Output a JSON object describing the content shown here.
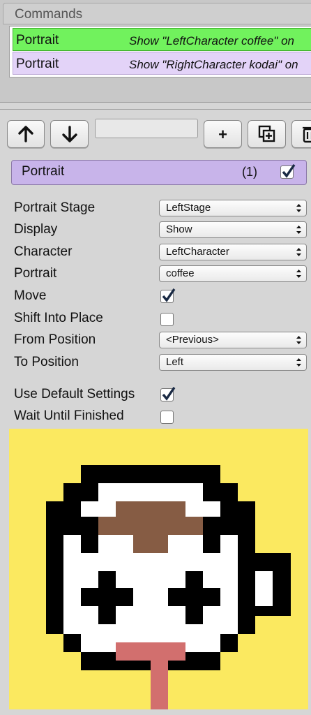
{
  "commands": {
    "header": "Commands",
    "rows": [
      {
        "name": "Portrait",
        "summary": "Show \"LeftCharacter coffee\" on",
        "color": "#71f25d"
      },
      {
        "name": "Portrait",
        "summary": "Show \"RightCharacter kodai\" on",
        "color": "#e3d3f8"
      }
    ]
  },
  "toolbar": {
    "buttons": [
      "up-arrow-icon",
      "down-arrow-icon",
      "plus-icon",
      "duplicate-icon",
      "trash-icon"
    ],
    "add_label": "+",
    "search_value": ""
  },
  "inspector": {
    "title": "Portrait",
    "index": "(1)",
    "enabled": true,
    "title_color": "#c8b4ea",
    "fields": [
      {
        "label": "Portrait Stage",
        "value": "LeftStage"
      },
      {
        "label": "Display",
        "value": "Show"
      },
      {
        "label": "Character",
        "value": "LeftCharacter"
      },
      {
        "label": "Portrait",
        "value": "coffee"
      }
    ],
    "move_label": "Move",
    "move_checked": true,
    "shift_label": "Shift Into Place",
    "shift_checked": false,
    "from_label": "From Position",
    "from_value": "<Previous>",
    "to_label": "To Position",
    "to_value": "Left",
    "use_default_label": "Use Default Settings",
    "use_default_checked": true,
    "wait_label": "Wait Until Finished",
    "wait_checked": false
  },
  "preview": {
    "background": "#fbe960",
    "subject": "pixel-art coffee cup character"
  }
}
